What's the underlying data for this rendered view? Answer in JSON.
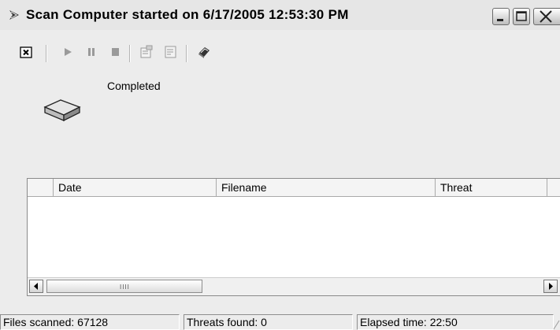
{
  "window": {
    "title": "Scan Computer started on 6/17/2005 12:53:30 PM",
    "title_icon": "scan-arrow-icon"
  },
  "toolbar": {
    "buttons": [
      {
        "name": "close-scan-icon",
        "glyph": "✕"
      },
      {
        "name": "play-icon",
        "glyph": "▶"
      },
      {
        "name": "pause-icon",
        "glyph": "❚❚"
      },
      {
        "name": "stop-icon",
        "glyph": "■"
      },
      {
        "name": "properties-icon"
      },
      {
        "name": "export-icon"
      },
      {
        "name": "help-book-icon"
      }
    ]
  },
  "status": {
    "label": "Completed",
    "icon": "drive-icon"
  },
  "list": {
    "columns": [
      "",
      "Date",
      "Filename",
      "Threat"
    ],
    "rows": [],
    "scroll": {
      "grip": "IIII"
    }
  },
  "statusbar": {
    "files_scanned": "Files scanned: 67128",
    "threats_found": "Threats found: 0",
    "elapsed_time": "Elapsed time: 22:50"
  },
  "colors": {
    "window_bg": "#ececec",
    "list_bg": "#ffffff"
  }
}
